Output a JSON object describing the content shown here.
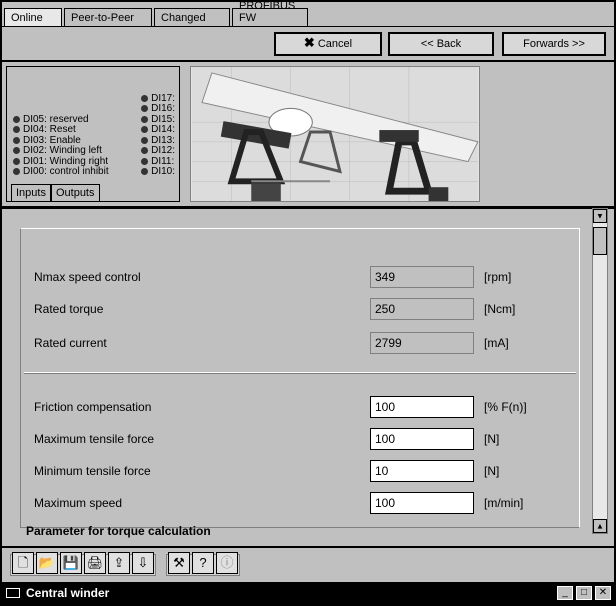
{
  "window": {
    "title": "Central winder"
  },
  "tabs": [
    {
      "label": "Online"
    },
    {
      "label": "Peer-to-Peer"
    },
    {
      "label": "Changed"
    },
    {
      "label": "PROFIBUS FW"
    }
  ],
  "nav_buttons": {
    "cancel": "Cancel",
    "back": "<< Back",
    "forward": "Forwards >>"
  },
  "io_panel": {
    "tabs": [
      "Inputs",
      "Outputs"
    ],
    "left_items": [
      "DI00: control inhibit",
      "DI01: Winding right",
      "DI02: Winding left",
      "DI03: Enable",
      "DI04: Reset",
      "DI05: reserved"
    ],
    "right_items": [
      "DI10:",
      "DI11:",
      "DI12:",
      "DI13:",
      "DI14:",
      "DI15:",
      "DI16:",
      "DI17:"
    ]
  },
  "parameters": {
    "section_title": "Parameter for torque calculation",
    "editable": [
      {
        "label": "Maximum speed",
        "value": "100",
        "unit": "[m/min]"
      },
      {
        "label": "Minimum tensile force",
        "value": "10",
        "unit": "[N]"
      },
      {
        "label": "Maximum tensile force",
        "value": "100",
        "unit": "[N]"
      },
      {
        "label": "Friction compensation",
        "value": "100",
        "unit": "[% F(n)]"
      }
    ],
    "readonly": [
      {
        "label": "Rated current",
        "value": "2799",
        "unit": "[mA]"
      },
      {
        "label": "Rated torque",
        "value": "250",
        "unit": "[Ncm]"
      },
      {
        "label": "Nmax speed control",
        "value": "349",
        "unit": "[rpm]"
      }
    ]
  },
  "toolbar": {
    "icons": [
      "new-icon",
      "open-icon",
      "save-icon",
      "print-icon",
      "export-icon",
      "import-icon",
      "tools-icon",
      "help-icon",
      "info-icon"
    ]
  }
}
